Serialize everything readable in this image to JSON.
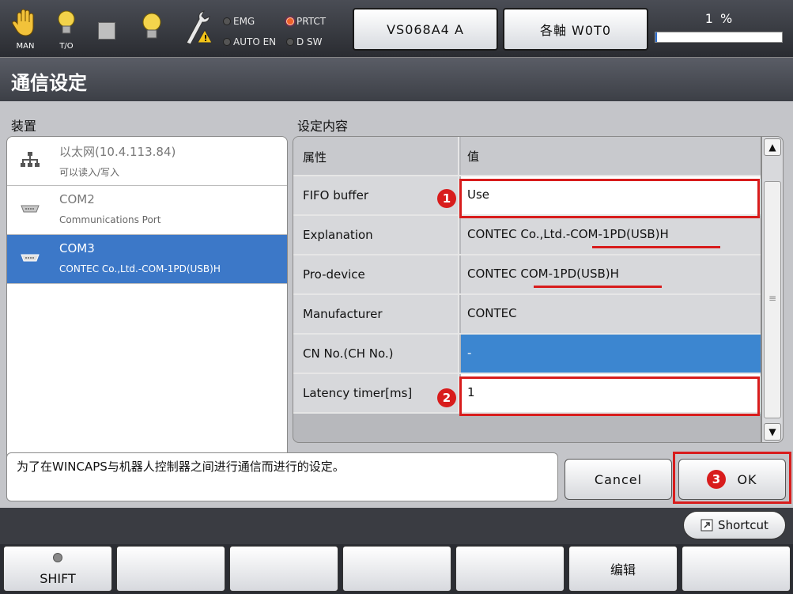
{
  "topbar": {
    "mode_label": "MAN",
    "io_label": "T/O",
    "lamps": {
      "emg": "EMG",
      "prtct": "PRTCT",
      "autoen": "AUTO EN",
      "dsw": "D SW"
    },
    "robot_button": "VS068A4 A",
    "axis_button": "各軸 W0T0",
    "speed_text": "1 %",
    "speed_percent": 1
  },
  "page_title": "通信设定",
  "device_section_label": "装置",
  "settings_section_label": "设定内容",
  "devices": [
    {
      "name": "以太网(10.4.113.84)",
      "desc": "可以读入/写入",
      "icon": "ethernet-network-icon"
    },
    {
      "name": "COM2",
      "desc": "Communications Port",
      "icon": "serial-port-icon"
    },
    {
      "name": "COM3",
      "desc": "CONTEC Co.,Ltd.-COM-1PD(USB)H",
      "icon": "serial-port-icon",
      "selected": true
    }
  ],
  "settings_table": {
    "headers": {
      "key": "属性",
      "value": "值"
    },
    "rows": [
      {
        "key": "FIFO buffer",
        "value": "Use"
      },
      {
        "key": "Explanation",
        "value": "CONTEC Co.,Ltd.-COM-1PD(USB)H"
      },
      {
        "key": "Pro-device",
        "value": "CONTEC COM-1PD(USB)H"
      },
      {
        "key": "Manufacturer",
        "value": "CONTEC"
      },
      {
        "key": "CN No.(CH No.)",
        "value": "-"
      },
      {
        "key": "Latency timer[ms]",
        "value": "1"
      }
    ]
  },
  "callouts": {
    "one": "1",
    "two": "2",
    "three": "3"
  },
  "description": "为了在WINCAPS与机器人控制器之间进行通信而进行的设定。",
  "buttons": {
    "cancel": "Cancel",
    "ok": "OK",
    "shortcut": "Shortcut"
  },
  "function_keys": [
    "SHIFT",
    "",
    "",
    "",
    "",
    "编辑",
    ""
  ],
  "colors": {
    "accent_blue": "#3c78c8",
    "highlight_red": "#d81c1c"
  }
}
